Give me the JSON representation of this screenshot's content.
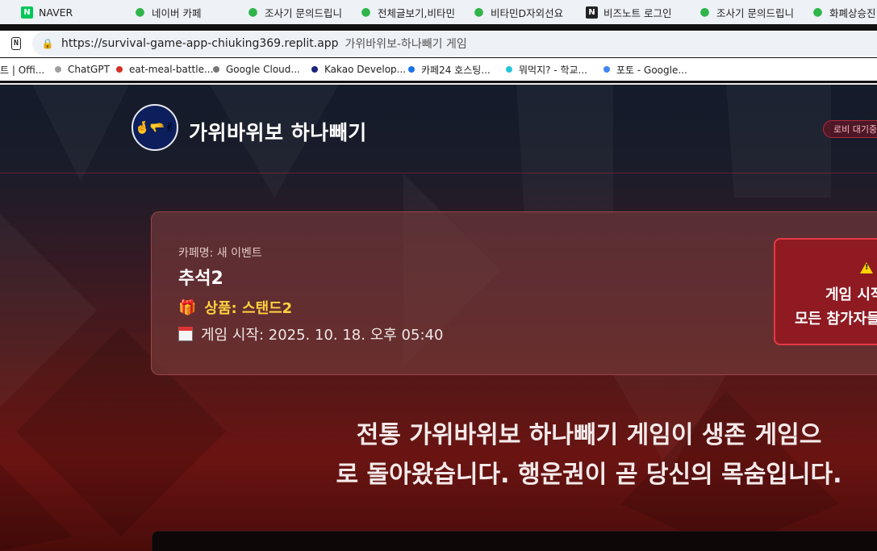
{
  "browser": {
    "tabs": [
      {
        "label": "NAVER",
        "icon": "naver-icon"
      },
      {
        "label": "네이버 카페",
        "icon": "cafe-leaf-icon"
      },
      {
        "label": "조사기 문의드립니",
        "icon": "cafe-leaf-icon"
      },
      {
        "label": "전체글보기,비타민",
        "icon": "cafe-leaf-icon"
      },
      {
        "label": "비타민D자외선요",
        "icon": "cafe-leaf-icon"
      },
      {
        "label": "비즈노트 로그인",
        "icon": "biznote-icon"
      },
      {
        "label": "조사기 문의드립니",
        "icon": "cafe-leaf-icon"
      },
      {
        "label": "화폐상승진",
        "icon": "cafe-leaf-icon"
      }
    ],
    "url": "https://survival-game-app-chiuking369.replit.app",
    "page_title": "가위바위보-하나빼기 게임",
    "bookmarks": [
      {
        "label": "트 | Offi...",
        "color": ""
      },
      {
        "label": "ChatGPT",
        "color": "#9e9e9e"
      },
      {
        "label": "eat-meal-battle...",
        "color": "#d93025"
      },
      {
        "label": "Google Cloud...",
        "color": "#777777"
      },
      {
        "label": "Kakao Develop...",
        "color": "#1a237e"
      },
      {
        "label": "카페24 호스팅...",
        "color": "#1a73e8"
      },
      {
        "label": "뭐먹지? - 학교...",
        "color": "#26c6da"
      },
      {
        "label": "포토 - Google...",
        "color": "#4285f4"
      }
    ]
  },
  "header": {
    "brand": "가위바위보 하나빼기",
    "logo_glyphs": "🤞🫳✌",
    "lobby_badge": "로비 대기중"
  },
  "event": {
    "cafe_name": "카페명: 새 이벤트",
    "title": "추석2",
    "prize": "상품: 스탠드2",
    "start_time": "게임 시작: 2025. 10. 18. 오후 05:40"
  },
  "warning": {
    "line1": "게임 시작",
    "line2": "모든 참가자들"
  },
  "tagline": {
    "line1": "전통 가위바위보 하나빼기 게임이 생존 게임으",
    "line2": "로 돌아왔습니다. 행운권이 곧 당신의 목숨입니다."
  },
  "colors": {
    "accent_gold": "#ffd23f",
    "warning_red": "#8f1a22",
    "badge_pink": "#ffb6c1"
  }
}
